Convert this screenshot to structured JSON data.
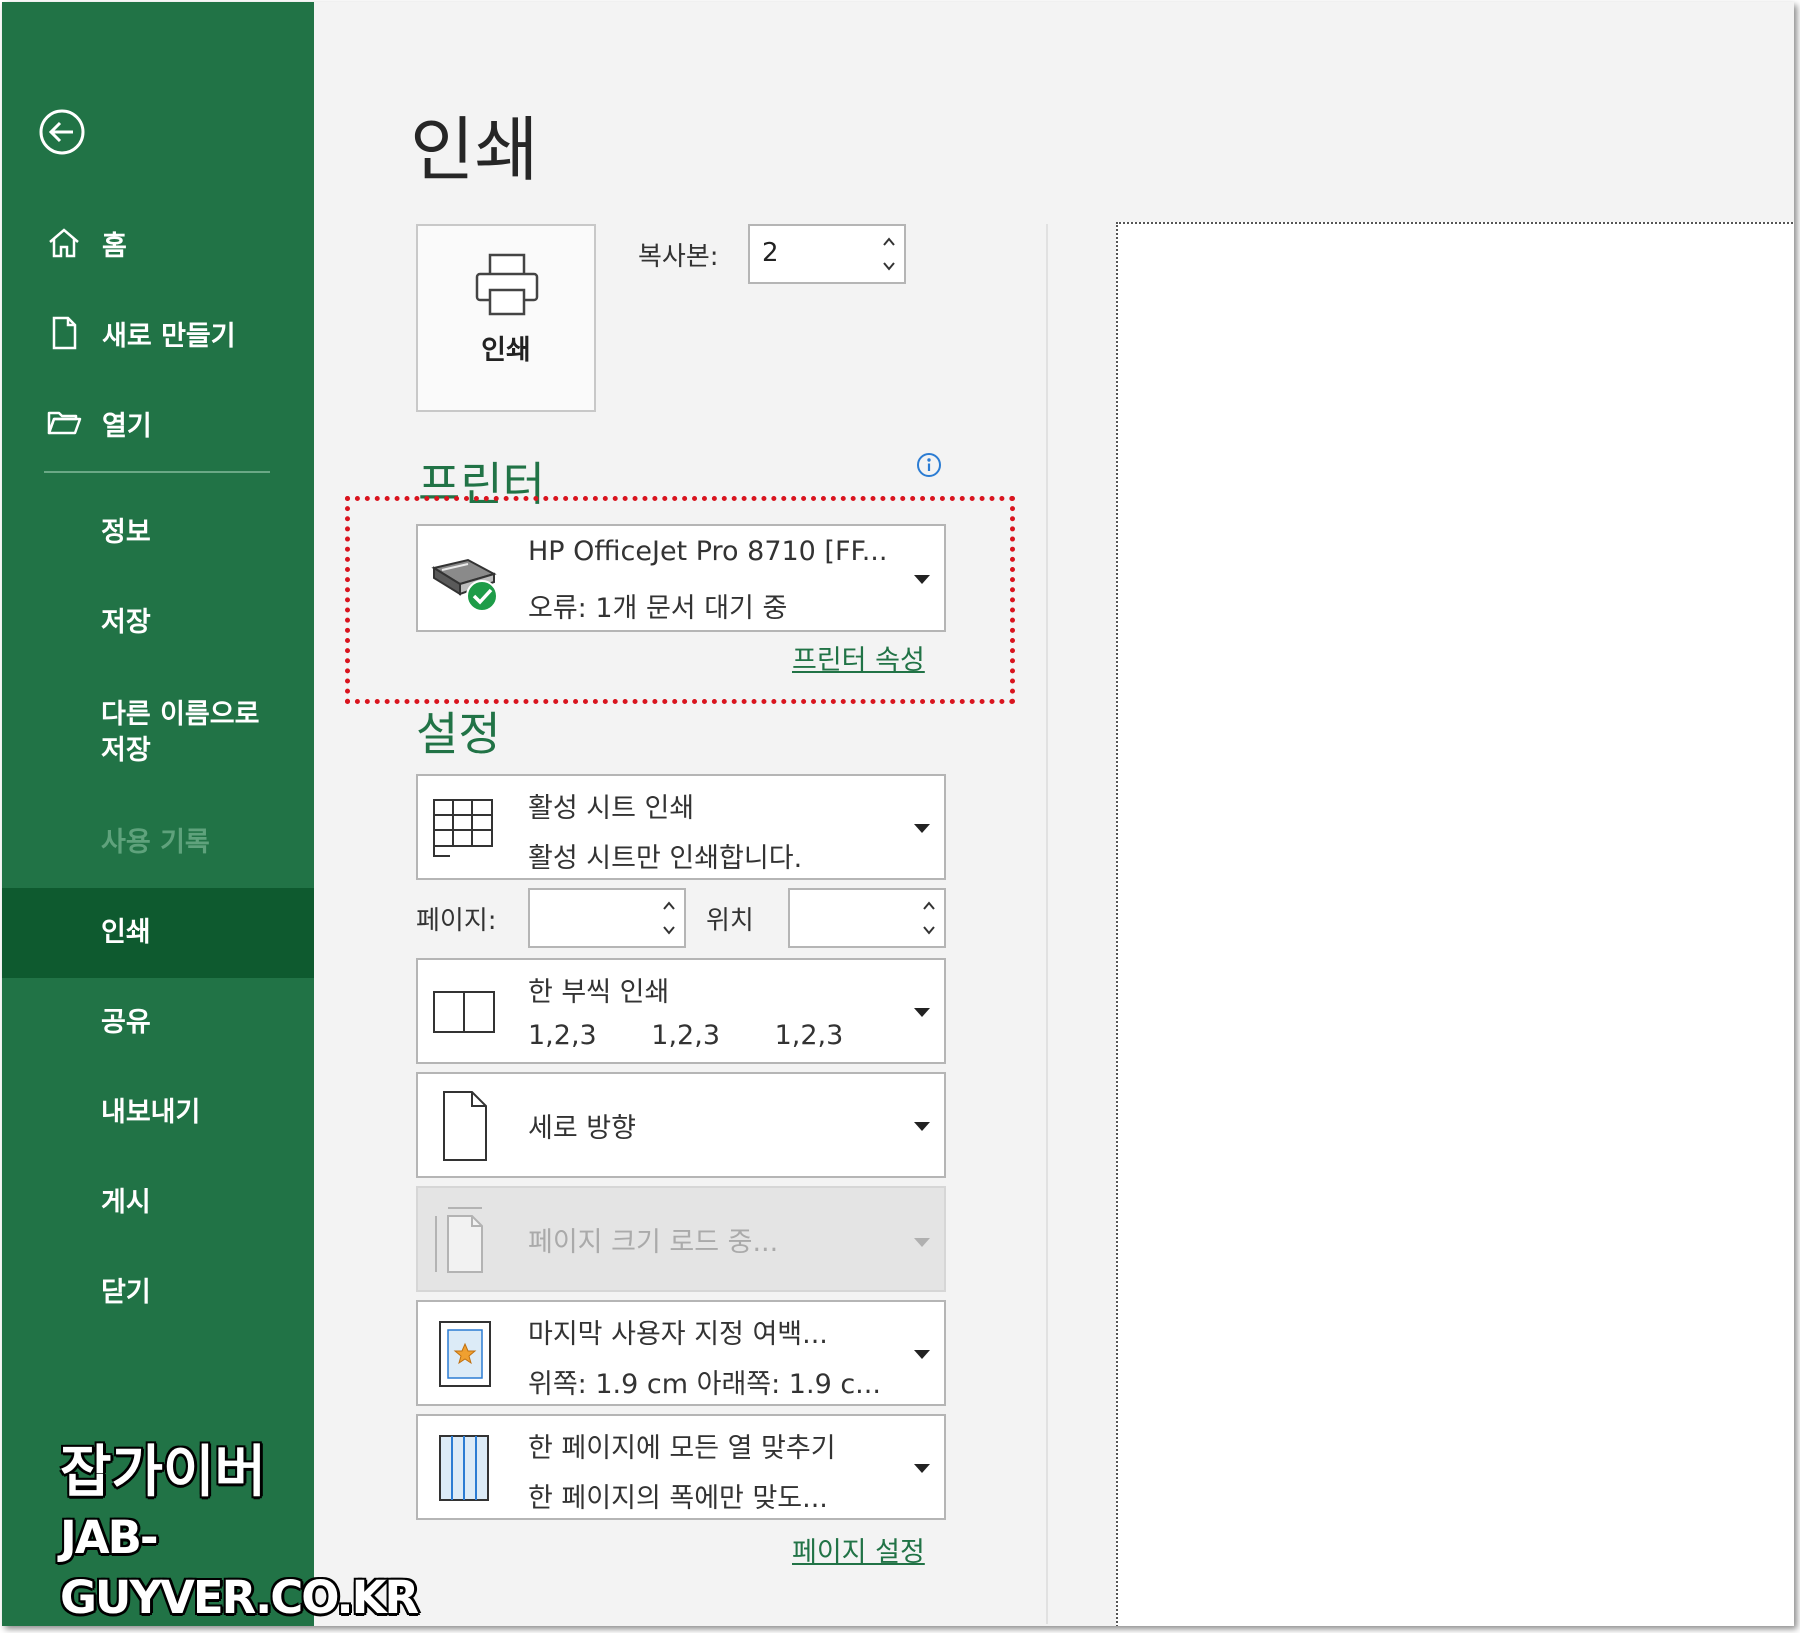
{
  "sidebar": {
    "nav_top": [
      {
        "label": "홈",
        "icon": "home-icon"
      },
      {
        "label": "새로 만들기",
        "icon": "new-document-icon"
      },
      {
        "label": "열기",
        "icon": "open-folder-icon"
      }
    ],
    "nav_bottom": [
      {
        "label": "정보",
        "state": "normal"
      },
      {
        "label": "저장",
        "state": "normal"
      },
      {
        "label": "다른 이름으로 저장",
        "line1": "다른 이름으로",
        "line2": "저장",
        "state": "normal"
      },
      {
        "label": "사용 기록",
        "state": "disabled"
      },
      {
        "label": "인쇄",
        "state": "selected"
      },
      {
        "label": "공유",
        "state": "normal"
      },
      {
        "label": "내보내기",
        "state": "normal"
      },
      {
        "label": "게시",
        "state": "normal"
      },
      {
        "label": "닫기",
        "state": "normal"
      }
    ]
  },
  "main": {
    "title": "인쇄",
    "print_button_label": "인쇄",
    "copies_label": "복사본:",
    "copies_value": "2",
    "printer_section_title": "프린터",
    "printer": {
      "name": "HP OfficeJet Pro 8710 [FF...",
      "status": "오류: 1개 문서 대기 중",
      "properties_link": "프린터 속성"
    },
    "settings_section_title": "설정",
    "settings": {
      "scope": {
        "title": "활성 시트 인쇄",
        "desc": "활성 시트만 인쇄합니다."
      },
      "pages_label": "페이지:",
      "pages_from": "",
      "to_label": "위치",
      "pages_to": "",
      "collation": {
        "title": "한 부씩 인쇄",
        "seq1": "1,2,3",
        "seq2": "1,2,3",
        "seq3": "1,2,3"
      },
      "orientation": {
        "title": "세로 방향"
      },
      "paper_size": {
        "title": "페이지 크기 로드 중..."
      },
      "margins": {
        "title": "마지막 사용자 지정 여백...",
        "desc": "위쪽: 1.9 cm 아래쪽: 1.9 c..."
      },
      "scaling": {
        "title": "한 페이지에 모든 열 맞추기",
        "desc": "한 페이지의 폭에만 맞도..."
      },
      "page_setup_link": "페이지 설정"
    }
  },
  "watermark": {
    "line1": "잡가이버",
    "line2": "JAB-GUYVER.CO.KR"
  },
  "colors": {
    "sidebar": "#217346",
    "selected": "#0e5a2f",
    "accent": "#217346",
    "highlight": "#d9141e"
  }
}
